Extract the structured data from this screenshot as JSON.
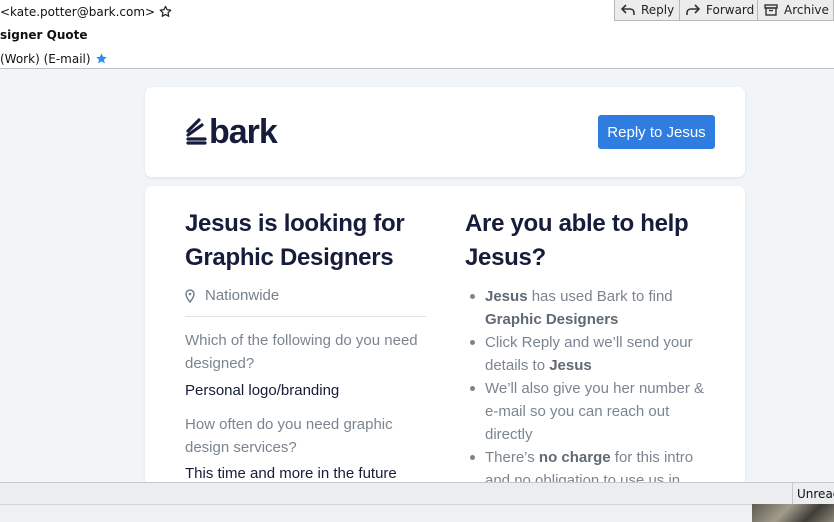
{
  "header": {
    "from": "<kate.potter@bark.com>",
    "subject": "signer Quote",
    "to": "(Work) (E-mail)",
    "star_icon": "star-outline-icon",
    "contact_star_icon": "star-filled-icon",
    "accent": "#2f8ff0"
  },
  "toolbar": {
    "reply_label": "Reply",
    "forward_label": "Forward",
    "archive_label": "Archive"
  },
  "email": {
    "logo_text": "bark",
    "reply_button": "Reply to Jesus",
    "left_heading": "Jesus is looking for Graphic Designers",
    "location": "Nationwide",
    "questions": [
      {
        "q": "Which of the following do you need designed?",
        "a": "Personal logo/branding"
      },
      {
        "q": "How often do you need graphic design services?",
        "a": "This time and more in the future"
      }
    ],
    "right_heading": "Are you able to help Jesus?",
    "bullets": [
      {
        "parts": [
          {
            "b": "Jesus"
          },
          {
            "t": " has used Bark to find "
          },
          {
            "b": "Graphic Designers"
          }
        ]
      },
      {
        "parts": [
          {
            "t": "Click Reply and we’ll send your details to "
          },
          {
            "b": "Jesus"
          }
        ]
      },
      {
        "parts": [
          {
            "t": "We’ll also give you her number & e-mail so you can reach out directly"
          }
        ]
      },
      {
        "parts": [
          {
            "t": "There’s "
          },
          {
            "b": "no charge"
          },
          {
            "t": " for this intro and no obligation to use us in"
          }
        ]
      }
    ],
    "brand_color": "#161c3a",
    "button_color": "#2f7de1"
  },
  "status": {
    "unread": "Unread"
  }
}
